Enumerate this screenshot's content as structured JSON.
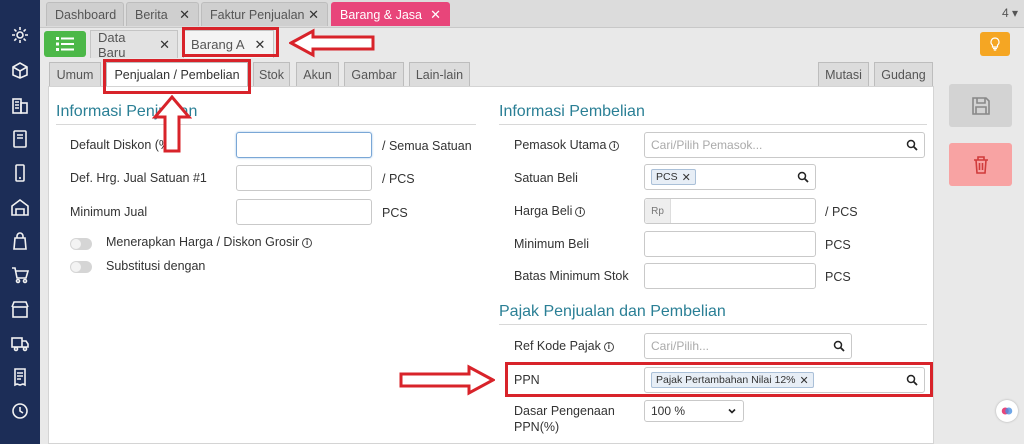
{
  "top_tabs": [
    {
      "label": "Dashboard",
      "closable": false
    },
    {
      "label": "Berita",
      "closable": true
    },
    {
      "label": "Faktur Penjualan",
      "closable": true
    },
    {
      "label": "Barang & Jasa",
      "closable": true,
      "active": true
    }
  ],
  "top_tab_count": "4",
  "second_tabs": [
    {
      "label": "Data Baru",
      "closable": true
    },
    {
      "label": "Barang A",
      "closable": true,
      "active": true
    }
  ],
  "sub_tabs_left": [
    "Umum",
    "Penjualan / Pembelian",
    "Stok",
    "Akun",
    "Gambar",
    "Lain-lain"
  ],
  "sub_tabs_right": [
    "Mutasi",
    "Gudang"
  ],
  "sales": {
    "title": "Informasi Penjualan",
    "default_discount_label": "Default Diskon (%",
    "default_discount_value": "",
    "default_discount_unit": "/ Semua Satuan",
    "def_price_label": "Def. Hrg. Jual Satuan #1",
    "def_price_unit": "/ PCS",
    "min_sale_label": "Minimum Jual",
    "min_sale_unit": "PCS",
    "toggle_grosir_label": "Menerapkan Harga / Diskon Grosir",
    "toggle_subst_label": "Substitusi dengan"
  },
  "purchase": {
    "title": "Informasi Pembelian",
    "supplier_label": "Pemasok Utama",
    "supplier_placeholder": "Cari/Pilih Pemasok...",
    "unit_label": "Satuan Beli",
    "unit_chip": "PCS",
    "price_label": "Harga Beli",
    "price_prefix": "Rp",
    "price_unit": "/ PCS",
    "min_buy_label": "Minimum Beli",
    "min_buy_unit": "PCS",
    "min_stock_label": "Batas Minimum Stok",
    "min_stock_unit": "PCS"
  },
  "tax": {
    "title": "Pajak Penjualan dan Pembelian",
    "ref_label": "Ref Kode Pajak",
    "ref_placeholder": "Cari/Pilih...",
    "ppn_label": "PPN",
    "ppn_chip": "Pajak Pertambahan Nilai 12%",
    "base_label_1": "Dasar Pengenaan",
    "base_label_2": "PPN(%)",
    "base_value": "100 %"
  },
  "colors": {
    "sidebar": "#1c2d57",
    "active_tab": "#e8457a",
    "section_title": "#2a7f95",
    "annotation": "#d8232a"
  },
  "icons": {
    "sidebar": [
      "gear-icon",
      "box-stack-icon",
      "building-icon",
      "book-icon",
      "phone-icon",
      "warehouse-icon",
      "bag-icon",
      "cart-icon",
      "shop-icon",
      "truck-icon",
      "receipt-icon",
      "tax-icon",
      "report-icon"
    ]
  }
}
